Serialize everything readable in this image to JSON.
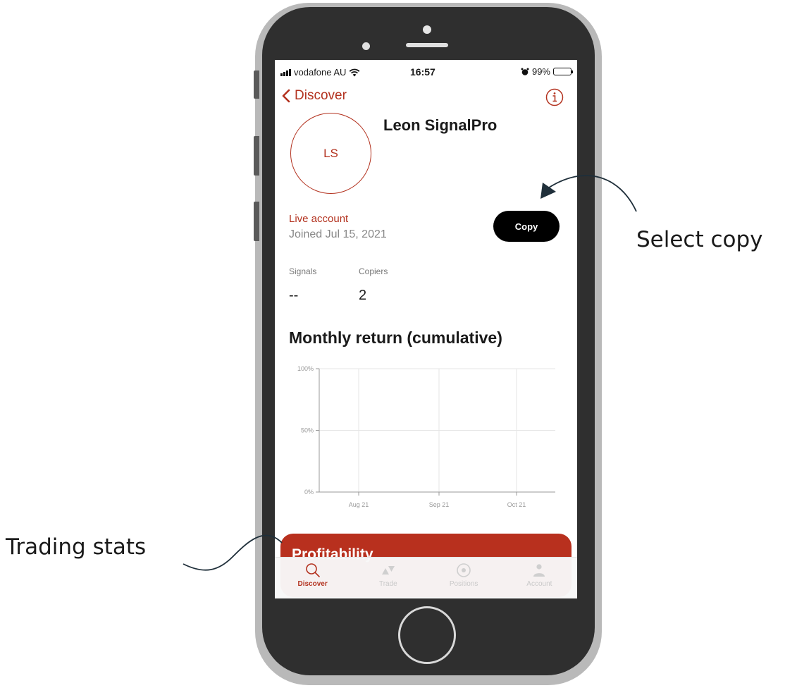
{
  "status_bar": {
    "carrier": "vodafone AU",
    "time": "16:57",
    "battery": "99%"
  },
  "nav": {
    "back_label": "Discover"
  },
  "profile": {
    "initials": "LS",
    "name": "Leon SignalPro",
    "account_type": "Live account",
    "joined": "Joined Jul 15, 2021",
    "copy_label": "Copy"
  },
  "stats": [
    {
      "label": "Signals",
      "value": "--"
    },
    {
      "label": "Copiers",
      "value": "2"
    }
  ],
  "chart_section_title": "Monthly return (cumulative)",
  "chart_data": {
    "type": "line",
    "title": "Monthly return (cumulative)",
    "categories": [
      "Aug 21",
      "Sep 21",
      "Oct 21"
    ],
    "y_ticks": [
      "0%",
      "50%",
      "100%"
    ],
    "ylim": [
      0,
      100
    ],
    "series": [],
    "grid": true
  },
  "profit_card": {
    "title": "Profitability"
  },
  "tabs": [
    {
      "label": "Discover",
      "icon": "search-icon",
      "active": true
    },
    {
      "label": "Trade",
      "icon": "trade-icon",
      "active": false
    },
    {
      "label": "Positions",
      "icon": "positions-icon",
      "active": false
    },
    {
      "label": "Account",
      "icon": "account-icon",
      "active": false
    }
  ],
  "annotations": {
    "select_copy": "Select copy",
    "trading_stats": "Trading stats"
  },
  "colors": {
    "accent": "#b3321f",
    "card": "#b8301e",
    "button": "#000000"
  }
}
